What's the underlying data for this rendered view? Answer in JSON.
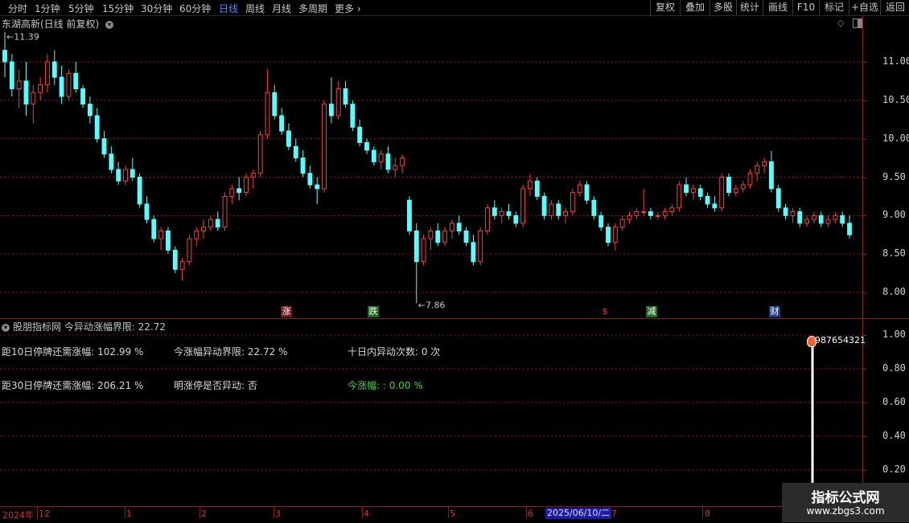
{
  "toolbar": {
    "periods": [
      "分时",
      "1分钟",
      "5分钟",
      "15分钟",
      "30分钟",
      "60分钟",
      "日线",
      "周线",
      "月线",
      "多周期",
      "更多"
    ],
    "active_period": "日线",
    "buttons": [
      "复权",
      "叠加",
      "多股",
      "统计",
      "画线",
      "F10",
      "标记",
      "+自选",
      "返回"
    ]
  },
  "chart": {
    "title": "东湖高新(日线 前复权)",
    "high_label": "11.39",
    "low_label": "7.86",
    "axis_labels": [
      "11.00",
      "10.50",
      "10.00",
      "9.50",
      "9.00",
      "8.50",
      "8.00"
    ],
    "events": [
      "涨",
      "跌",
      "$",
      "减",
      "财"
    ],
    "colors": {
      "up": "#ff3c3c",
      "down": "#54ffff",
      "background": "#000000",
      "grid": "#8b1a1a"
    }
  },
  "chart_data": {
    "type": "candlestick",
    "series_name": "东湖高新",
    "ylim": [
      7.7,
      11.6
    ],
    "x_ticks": [
      "2024年",
      "12",
      "1",
      "2",
      "3",
      "4",
      "5",
      "6",
      "7",
      "8"
    ],
    "candles": [
      [
        11.15,
        11.39,
        10.8,
        11.0
      ],
      [
        11.0,
        11.1,
        10.55,
        10.65
      ],
      [
        10.65,
        10.9,
        10.4,
        10.75
      ],
      [
        10.75,
        11.0,
        10.3,
        10.45
      ],
      [
        10.45,
        10.7,
        10.2,
        10.6
      ],
      [
        10.6,
        10.8,
        10.5,
        10.7
      ],
      [
        10.7,
        11.1,
        10.6,
        11.0
      ],
      [
        11.0,
        11.15,
        10.7,
        10.8
      ],
      [
        10.8,
        10.95,
        10.45,
        10.55
      ],
      [
        10.55,
        10.9,
        10.5,
        10.85
      ],
      [
        10.85,
        11.0,
        10.6,
        10.65
      ],
      [
        10.65,
        10.7,
        10.4,
        10.45
      ],
      [
        10.45,
        10.55,
        10.2,
        10.3
      ],
      [
        10.3,
        10.4,
        9.95,
        10.0
      ],
      [
        10.0,
        10.1,
        9.75,
        9.8
      ],
      [
        9.8,
        9.9,
        9.55,
        9.6
      ],
      [
        9.6,
        9.7,
        9.4,
        9.45
      ],
      [
        9.45,
        9.65,
        9.4,
        9.6
      ],
      [
        9.6,
        9.75,
        9.45,
        9.5
      ],
      [
        9.5,
        9.55,
        9.1,
        9.15
      ],
      [
        9.15,
        9.25,
        8.9,
        8.95
      ],
      [
        8.95,
        9.0,
        8.65,
        8.7
      ],
      [
        8.7,
        8.85,
        8.55,
        8.8
      ],
      [
        8.8,
        8.85,
        8.5,
        8.55
      ],
      [
        8.55,
        8.6,
        8.25,
        8.3
      ],
      [
        8.3,
        8.45,
        8.15,
        8.4
      ],
      [
        8.4,
        8.75,
        8.35,
        8.7
      ],
      [
        8.7,
        8.85,
        8.6,
        8.8
      ],
      [
        8.8,
        8.95,
        8.7,
        8.85
      ],
      [
        8.85,
        9.0,
        8.8,
        8.95
      ],
      [
        8.95,
        9.05,
        8.8,
        8.85
      ],
      [
        8.85,
        9.3,
        8.8,
        9.25
      ],
      [
        9.25,
        9.4,
        9.15,
        9.35
      ],
      [
        9.35,
        9.5,
        9.2,
        9.3
      ],
      [
        9.3,
        9.55,
        9.25,
        9.5
      ],
      [
        9.5,
        9.6,
        9.35,
        9.55
      ],
      [
        9.55,
        10.1,
        9.5,
        10.05
      ],
      [
        10.05,
        10.9,
        10.0,
        10.6
      ],
      [
        10.6,
        10.7,
        10.25,
        10.3
      ],
      [
        10.3,
        10.4,
        10.05,
        10.1
      ],
      [
        10.1,
        10.2,
        9.85,
        9.9
      ],
      [
        9.9,
        10.0,
        9.7,
        9.75
      ],
      [
        9.75,
        9.85,
        9.5,
        9.55
      ],
      [
        9.55,
        9.65,
        9.35,
        9.4
      ],
      [
        9.4,
        9.5,
        9.15,
        9.35
      ],
      [
        9.35,
        10.5,
        9.3,
        10.45
      ],
      [
        10.45,
        10.8,
        10.2,
        10.3
      ],
      [
        10.3,
        10.75,
        10.25,
        10.65
      ],
      [
        10.65,
        10.75,
        10.4,
        10.45
      ],
      [
        10.45,
        10.5,
        10.1,
        10.15
      ],
      [
        10.15,
        10.25,
        9.9,
        9.95
      ],
      [
        9.95,
        10.0,
        9.8,
        9.85
      ],
      [
        9.85,
        9.9,
        9.65,
        9.7
      ],
      [
        9.7,
        9.85,
        9.6,
        9.8
      ],
      [
        9.8,
        9.9,
        9.55,
        9.6
      ],
      [
        9.6,
        9.75,
        9.5,
        9.65
      ],
      [
        9.65,
        9.8,
        9.55,
        9.75
      ],
      [
        9.2,
        9.25,
        8.75,
        8.8
      ],
      [
        8.8,
        8.9,
        7.86,
        8.4
      ],
      [
        8.4,
        8.75,
        8.35,
        8.7
      ],
      [
        8.7,
        8.85,
        8.55,
        8.8
      ],
      [
        8.8,
        8.9,
        8.6,
        8.65
      ],
      [
        8.65,
        8.85,
        8.6,
        8.8
      ],
      [
        8.8,
        8.95,
        8.7,
        8.9
      ],
      [
        8.9,
        9.0,
        8.75,
        8.8
      ],
      [
        8.8,
        8.85,
        8.6,
        8.65
      ],
      [
        8.65,
        8.75,
        8.35,
        8.4
      ],
      [
        8.4,
        8.85,
        8.35,
        8.8
      ],
      [
        8.8,
        9.15,
        8.75,
        9.1
      ],
      [
        9.1,
        9.2,
        8.95,
        9.0
      ],
      [
        9.0,
        9.1,
        8.9,
        9.05
      ],
      [
        9.05,
        9.15,
        8.95,
        9.0
      ],
      [
        9.0,
        9.05,
        8.85,
        8.9
      ],
      [
        8.9,
        9.4,
        8.85,
        9.35
      ],
      [
        9.35,
        9.55,
        9.25,
        9.45
      ],
      [
        9.45,
        9.5,
        9.2,
        9.25
      ],
      [
        9.25,
        9.3,
        8.95,
        9.0
      ],
      [
        9.0,
        9.2,
        8.95,
        9.15
      ],
      [
        9.15,
        9.2,
        8.95,
        9.0
      ],
      [
        9.0,
        9.1,
        8.9,
        9.05
      ],
      [
        9.05,
        9.35,
        9.0,
        9.3
      ],
      [
        9.3,
        9.45,
        9.25,
        9.4
      ],
      [
        9.4,
        9.45,
        9.15,
        9.2
      ],
      [
        9.2,
        9.25,
        8.95,
        9.0
      ],
      [
        9.0,
        9.05,
        8.8,
        8.85
      ],
      [
        8.85,
        8.9,
        8.6,
        8.65
      ],
      [
        8.65,
        8.9,
        8.55,
        8.85
      ],
      [
        8.85,
        9.0,
        8.8,
        8.95
      ],
      [
        8.95,
        9.05,
        8.9,
        9.0
      ],
      [
        9.0,
        9.1,
        8.95,
        9.05
      ],
      [
        9.05,
        9.35,
        9.0,
        9.05
      ],
      [
        9.05,
        9.1,
        8.95,
        9.0
      ],
      [
        9.0,
        9.05,
        8.95,
        9.0
      ],
      [
        9.0,
        9.1,
        8.95,
        9.05
      ],
      [
        9.05,
        9.15,
        9.0,
        9.1
      ],
      [
        9.1,
        9.45,
        9.05,
        9.4
      ],
      [
        9.4,
        9.5,
        9.25,
        9.3
      ],
      [
        9.3,
        9.4,
        9.2,
        9.35
      ],
      [
        9.35,
        9.4,
        9.2,
        9.25
      ],
      [
        9.25,
        9.3,
        9.1,
        9.15
      ],
      [
        9.15,
        9.25,
        9.05,
        9.1
      ],
      [
        9.1,
        9.55,
        9.05,
        9.5
      ],
      [
        9.5,
        9.55,
        9.25,
        9.3
      ],
      [
        9.3,
        9.4,
        9.25,
        9.35
      ],
      [
        9.35,
        9.45,
        9.3,
        9.4
      ],
      [
        9.4,
        9.6,
        9.35,
        9.55
      ],
      [
        9.55,
        9.7,
        9.45,
        9.65
      ],
      [
        9.65,
        9.75,
        9.55,
        9.7
      ],
      [
        9.7,
        9.84,
        9.3,
        9.35
      ],
      [
        9.35,
        9.4,
        9.05,
        9.1
      ],
      [
        9.1,
        9.15,
        8.95,
        9.0
      ],
      [
        9.0,
        9.1,
        8.9,
        9.05
      ],
      [
        9.05,
        9.1,
        8.85,
        8.9
      ],
      [
        8.9,
        9.0,
        8.85,
        8.95
      ],
      [
        8.95,
        9.05,
        8.9,
        9.0
      ],
      [
        9.0,
        9.05,
        8.85,
        8.9
      ],
      [
        8.9,
        9.0,
        8.85,
        8.95
      ],
      [
        8.95,
        9.05,
        8.9,
        9.0
      ],
      [
        9.0,
        9.05,
        8.85,
        8.9
      ],
      [
        8.9,
        9.0,
        8.7,
        8.75
      ]
    ]
  },
  "indicator": {
    "header": "股朋指标网 今异动涨幅界限: 22.72",
    "row1": [
      "距10日停牌还需涨幅: 102.99 %",
      "今涨幅异动界限: 22.72 %",
      "十日内异动次数: 0 次"
    ],
    "row2": [
      "距30日停牌还需涨幅: 206.21 %",
      "明涨停是否异动: 否",
      "今涨幅: : 0.00 %"
    ],
    "axis_labels": [
      "1.00",
      "0.80",
      "0.60",
      "0.40",
      "0.20"
    ],
    "signal_label": "987654321",
    "signal_value": 0.93
  },
  "bottom": {
    "labels": [
      "2024年",
      "12",
      "1",
      "2",
      "3",
      "4",
      "5",
      "6",
      "7",
      "8"
    ],
    "cursor_date": "2025/06/10/二"
  },
  "watermark": {
    "line1": "指标公式网",
    "line2": "www.zbgs3.com"
  }
}
